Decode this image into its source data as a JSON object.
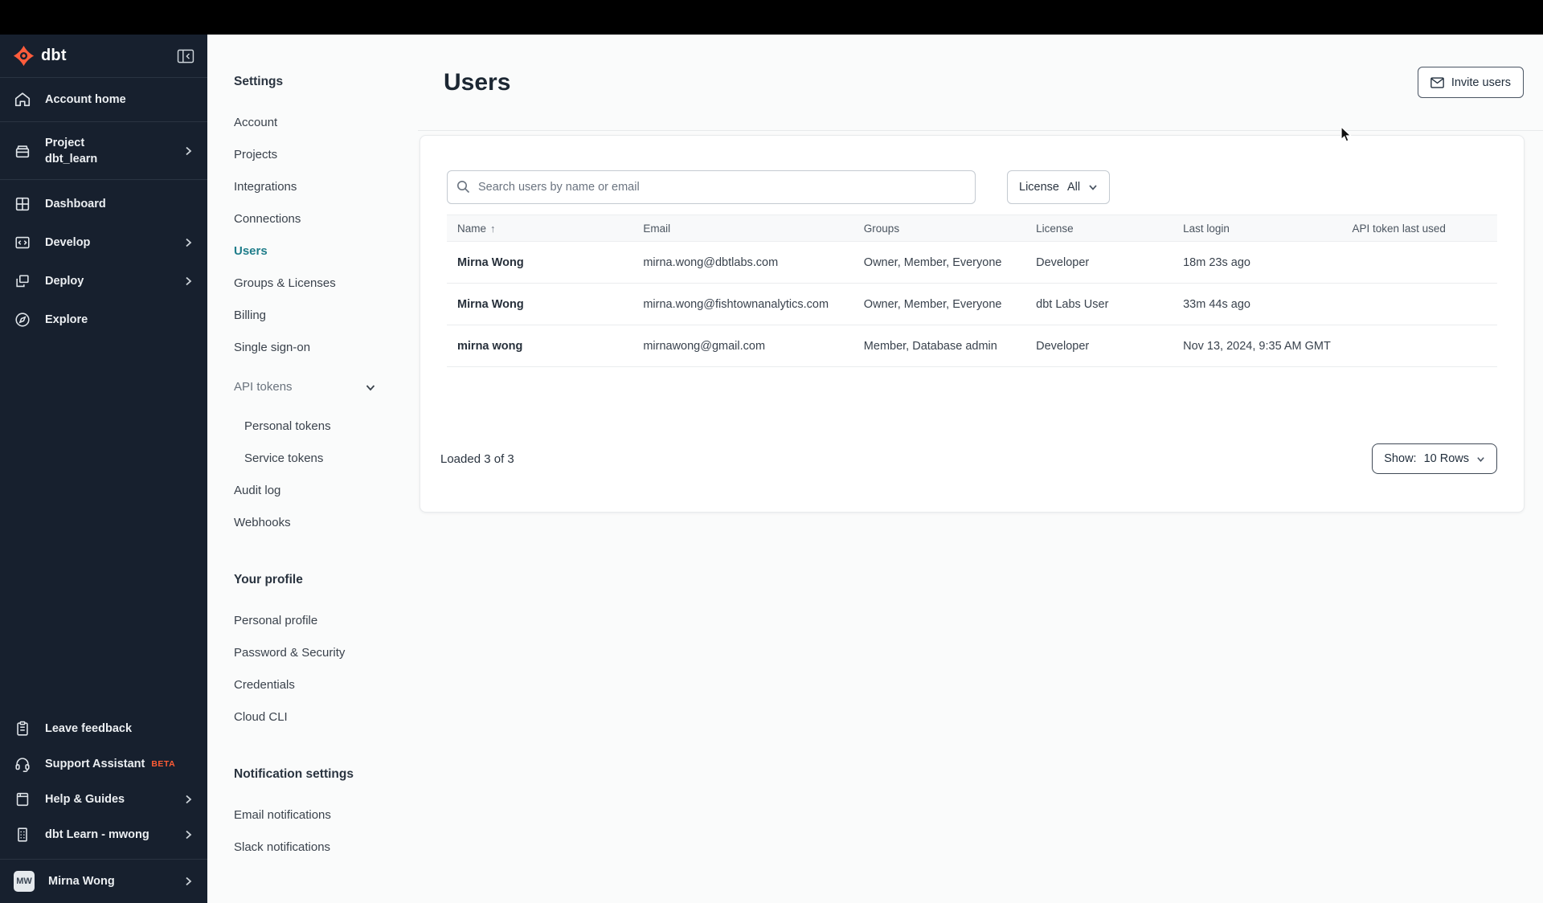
{
  "colors": {
    "topbar_bg": "#000000",
    "sidebar_bg": "#17202e",
    "brand_orange": "#ff5c3c",
    "beta_orange": "#ff5c35",
    "active_teal": "#1f7d8a"
  },
  "sidebar": {
    "logo_text": "dbt",
    "nav": [
      {
        "label": "Account home",
        "icon": "home-icon"
      },
      {
        "label": "Project",
        "sublabel": "dbt_learn",
        "icon": "project-icon",
        "chevron": true
      },
      {
        "label": "Dashboard",
        "icon": "dashboard-icon"
      },
      {
        "label": "Develop",
        "icon": "develop-icon",
        "chevron": true
      },
      {
        "label": "Deploy",
        "icon": "deploy-icon",
        "chevron": true
      },
      {
        "label": "Explore",
        "icon": "explore-icon"
      }
    ],
    "footer": [
      {
        "label": "Leave feedback",
        "icon": "clipboard-icon"
      },
      {
        "label": "Support Assistant",
        "badge": "BETA",
        "icon": "headset-icon"
      },
      {
        "label": "Help & Guides",
        "icon": "book-icon",
        "chevron": true
      },
      {
        "label": "dbt Learn - mwong",
        "icon": "building-icon",
        "chevron": true
      }
    ],
    "user": {
      "initials": "MW",
      "name": "Mirna Wong"
    }
  },
  "settings_nav": {
    "title": "Settings",
    "items": [
      {
        "label": "Account"
      },
      {
        "label": "Projects"
      },
      {
        "label": "Integrations"
      },
      {
        "label": "Connections"
      },
      {
        "label": "Users",
        "active": true
      },
      {
        "label": "Groups & Licenses"
      },
      {
        "label": "Billing"
      },
      {
        "label": "Single sign-on"
      }
    ],
    "api_tokens": {
      "label": "API tokens",
      "children": [
        {
          "label": "Personal tokens"
        },
        {
          "label": "Service tokens"
        }
      ]
    },
    "items_after": [
      {
        "label": "Audit log"
      },
      {
        "label": "Webhooks"
      }
    ],
    "profile": {
      "title": "Your profile",
      "items": [
        {
          "label": "Personal profile"
        },
        {
          "label": "Password & Security"
        },
        {
          "label": "Credentials"
        },
        {
          "label": "Cloud CLI"
        }
      ]
    },
    "notifications": {
      "title": "Notification settings",
      "items": [
        {
          "label": "Email notifications"
        },
        {
          "label": "Slack notifications"
        }
      ]
    }
  },
  "main": {
    "title": "Users",
    "invite_button": "Invite users",
    "search_placeholder": "Search users by name or email",
    "license_filter": {
      "label": "License",
      "value": "All"
    },
    "table": {
      "columns": [
        "Name",
        "Email",
        "Groups",
        "License",
        "Last login",
        "API token last used"
      ],
      "sort_arrow": "↑",
      "rows": [
        {
          "name": "Mirna Wong",
          "email": "mirna.wong@dbtlabs.com",
          "groups": "Owner, Member, Everyone",
          "license": "Developer",
          "last_login": "18m 23s ago",
          "api_token_last_used": ""
        },
        {
          "name": "Mirna Wong",
          "email": "mirna.wong@fishtownanalytics.com",
          "groups": "Owner, Member, Everyone",
          "license": "dbt Labs User",
          "last_login": "33m 44s ago",
          "api_token_last_used": ""
        },
        {
          "name": "mirna wong",
          "email": "mirnawong@gmail.com",
          "groups": "Member, Database admin",
          "license": "Developer",
          "last_login": "Nov 13, 2024, 9:35 AM GMT",
          "api_token_last_used": ""
        }
      ]
    },
    "footer": {
      "loaded": "Loaded 3 of 3",
      "show_label": "Show:",
      "show_value": "10 Rows"
    }
  }
}
